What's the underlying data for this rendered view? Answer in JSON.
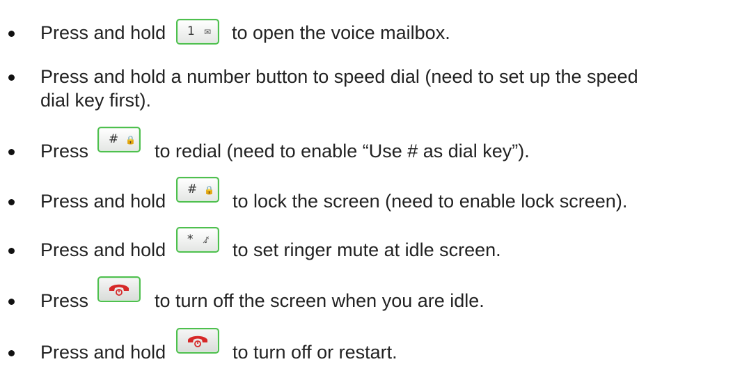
{
  "items": [
    {
      "pre": "Press and hold",
      "key": {
        "main": "1",
        "sub": "✉"
      },
      "post": "to open the voice mailbox."
    },
    {
      "text1": "Press and hold a number button to speed dial (need to set up the speed",
      "text2": "dial key first)."
    },
    {
      "pre": "Press",
      "key": {
        "main": "#",
        "sub": "🔒"
      },
      "post": "to redial (need to enable “Use # as dial key”)."
    },
    {
      "pre": "Press and hold",
      "key": {
        "main": "#",
        "sub": "🔒"
      },
      "post": "to lock the screen (need to enable lock screen)."
    },
    {
      "pre": "Press and hold",
      "key": {
        "main": "*",
        "sub": "♪̸"
      },
      "post": "to set ringer mute at idle screen."
    },
    {
      "pre": "Press",
      "key": {
        "icon": "hang-up-icon"
      },
      "post": "to turn off the screen when you are idle."
    },
    {
      "pre": "Press and hold",
      "key": {
        "icon": "hang-up-icon"
      },
      "post": "to turn off or restart."
    }
  ],
  "colors": {
    "key_border": "#4ec04e",
    "hangup": "#d62828"
  }
}
